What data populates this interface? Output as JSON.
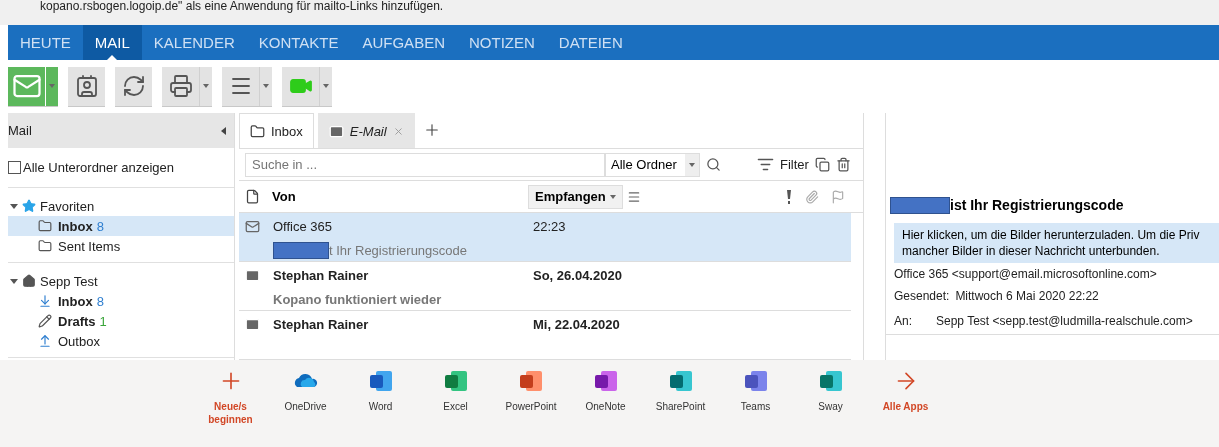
{
  "notice": {
    "text": "kopano.rsbogen.logoip.de\" als eine Anwendung für mailto-Links hinzufügen."
  },
  "nav": [
    {
      "label": "HEUTE",
      "selected": false
    },
    {
      "label": "MAIL",
      "selected": true
    },
    {
      "label": "KALENDER",
      "selected": false
    },
    {
      "label": "KONTAKTE",
      "selected": false
    },
    {
      "label": "AUFGABEN",
      "selected": false
    },
    {
      "label": "NOTIZEN",
      "selected": false
    },
    {
      "label": "DATEIEN",
      "selected": false
    }
  ],
  "toolbar": [
    {
      "kind": "mail",
      "split": true,
      "primary": true
    },
    {
      "kind": "contacts",
      "split": false,
      "primary": false
    },
    {
      "kind": "sync",
      "split": false,
      "primary": false
    },
    {
      "kind": "print",
      "split": true,
      "primary": false
    },
    {
      "kind": "layout",
      "split": true,
      "primary": false
    },
    {
      "kind": "video",
      "split": true,
      "primary": false
    }
  ],
  "sidebar": {
    "title": "Mail",
    "show_all_subfolders": {
      "label": "Alle Unterordner anzeigen",
      "checked": false
    },
    "trees": [
      {
        "label": "Favoriten",
        "kind": "favorites",
        "expanded": true,
        "children": [
          {
            "label": "Inbox",
            "count": "8",
            "color": "#2f7fd0",
            "kind": "folder",
            "selected": true
          },
          {
            "label": "Sent Items",
            "kind": "folder",
            "selected": false
          }
        ]
      },
      {
        "label": "Sepp Test",
        "kind": "home",
        "expanded": true,
        "children": [
          {
            "label": "Inbox",
            "count": "8",
            "color": "#2f7fd0",
            "kind": "inbox",
            "selected": false
          },
          {
            "label": "Drafts",
            "count": "1",
            "color": "#3aa53a",
            "kind": "drafts",
            "selected": false
          },
          {
            "label": "Outbox",
            "kind": "outbox",
            "selected": false
          }
        ]
      }
    ]
  },
  "tabs": [
    {
      "label": "Inbox",
      "kind": "folder",
      "selected": true,
      "closable": false
    },
    {
      "label": "E-Mail",
      "kind": "mail",
      "selected": false,
      "closable": true
    }
  ],
  "search": {
    "placeholder": "Suche in ...",
    "scope": "Alle Ordner",
    "filter": "Filter"
  },
  "columns": {
    "from": "Von",
    "received": "Empfangen",
    "sorted": true
  },
  "emails": [
    {
      "sender": "Office 365",
      "time": "22:23",
      "subject": "t Ihr Registrierungscode",
      "redacted": true,
      "unread": false,
      "selected": true
    },
    {
      "sender": "Stephan Rainer",
      "time": "So, 26.04.2020",
      "subject": "Kopano funktioniert wieder",
      "unread": true,
      "selected": false
    },
    {
      "sender": "Stephan Rainer",
      "time": "Mi, 22.04.2020",
      "unread": true,
      "selected": false
    }
  ],
  "preview": {
    "subject": "ist Ihr Registrierungscode",
    "redacted": true,
    "banner_lines": [
      "Hier klicken, um die Bilder herunterzuladen. Um die Priv",
      "mancher Bilder in dieser Nachricht unterbunden."
    ],
    "from": "Office 365 <support@email.microsoftonline.com>",
    "sent_label": "Gesendet:",
    "sent": "Mittwoch 6 Mai 2020 22:22",
    "to_label": "An:",
    "to": "Sepp Test <sepp.test@ludmilla-realschule.com>"
  },
  "apps": [
    {
      "label": "Neue/s beginnen",
      "kind": "new"
    },
    {
      "label": "OneDrive",
      "kind": "onedrive"
    },
    {
      "label": "Word",
      "kind": "word"
    },
    {
      "label": "Excel",
      "kind": "excel"
    },
    {
      "label": "PowerPoint",
      "kind": "powerpoint"
    },
    {
      "label": "OneNote",
      "kind": "onenote"
    },
    {
      "label": "SharePoint",
      "kind": "sharepoint"
    },
    {
      "label": "Teams",
      "kind": "teams"
    },
    {
      "label": "Sway",
      "kind": "sway"
    },
    {
      "label": "Alle Apps",
      "kind": "all"
    }
  ]
}
